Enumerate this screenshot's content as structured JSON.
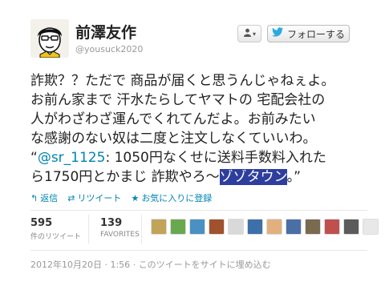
{
  "user": {
    "display_name": "前澤友作",
    "handle": "@yousuck2020"
  },
  "buttons": {
    "menu_glyph": "👤",
    "follow_label": "フォローする"
  },
  "tweet": {
    "line1": "詐欺？？ただで 商品が届くと思うんじゃねぇよ。",
    "line2": "お前ん家まで 汗水たらしてヤマトの 宅配会社の",
    "line3": "人がわざわざ運んでくれてんだよ。お前みたい",
    "line4": "な感謝のない奴は二度と注文しなくていいわ。",
    "quote_open": "“",
    "mention": "@sr_1125",
    "line5_rest": ": 1050円なくせに送料手数料入れた",
    "line6_pre": "ら1750円とかまじ 詐欺やろ～",
    "highlight": "ゾゾタウン",
    "line6_post": "。”"
  },
  "actions": {
    "reply": "返信",
    "retweet": "リツイート",
    "favorite": "お気に入りに登録"
  },
  "stats": {
    "retweets": "595",
    "retweets_label": "件のリツイート",
    "favorites": "139",
    "favorites_label": "FAVORITES"
  },
  "thumb_colors": [
    "#c2a35a",
    "#6aa84f",
    "#4a90c2",
    "#a0522d",
    "#d9d9d9",
    "#3d6fa8",
    "#e1b07e",
    "#4a6fa5",
    "#7a6a50",
    "#c0504d",
    "#5b5b5b",
    "#e8e8e8"
  ],
  "footer": {
    "timestamp": "2012年10月20日 · 1:56",
    "embed": "このツイートをサイトに埋め込む",
    "sep": "·"
  }
}
